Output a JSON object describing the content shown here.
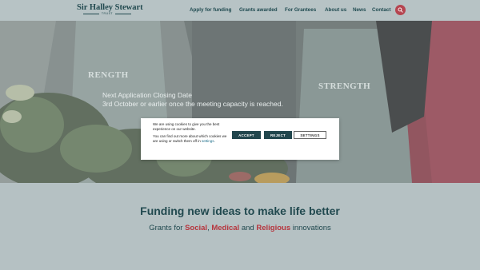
{
  "brand": {
    "name": "Sir Halley Stewart",
    "sub": "TRUST"
  },
  "nav": {
    "items": [
      "Apply for funding",
      "Grants awarded",
      "For Grantees",
      "About us",
      "News",
      "Contact"
    ]
  },
  "hero": {
    "line1": "Next Application Closing Date",
    "line2": "3rd October or earlier once the meeting capacity is reached.",
    "apron_left": "RENGTH",
    "apron_right": "STRENGTH"
  },
  "cookie": {
    "text1": "We are using cookies to give you the best experience on our website.",
    "text2_before": "You can find out more about which cookies we are using or switch them off in ",
    "text2_link": "settings",
    "text2_after": ".",
    "accept": "ACCEPT",
    "reject": "REJECT",
    "settings": "SETTINGS"
  },
  "intro": {
    "headline": "Funding new ideas to make life better",
    "sub_prefix": "Grants for ",
    "word1": "Social",
    "sep1": ", ",
    "word2": "Medical",
    "sep2": " and ",
    "word3": "Religious",
    "sub_suffix": " innovations"
  },
  "colors": {
    "brand": "#21494f",
    "accent": "#b6353e",
    "background": "#b5c1c3"
  },
  "icons": {
    "search": "search-icon"
  }
}
